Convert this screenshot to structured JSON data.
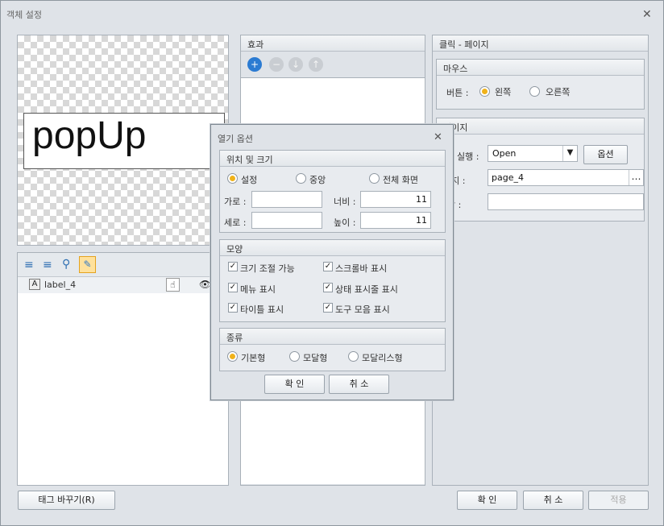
{
  "window": {
    "title": "객체 설정"
  },
  "preview": {
    "text": "popUp"
  },
  "layer": {
    "item_label": "label_4"
  },
  "buttons": {
    "tag_change": "태그 바꾸기(R)",
    "ok": "확 인",
    "cancel": "취 소",
    "apply": "적용"
  },
  "effects": {
    "header": "효과"
  },
  "right_panel": {
    "header": "클릭 - 페이지",
    "mouse": {
      "header": "마우스",
      "button_label": "버튼 :",
      "left": "왼쪽",
      "right": "오른쪽",
      "selected": "왼쪽"
    },
    "page": {
      "header": "페이지",
      "execute_label": "실행 :",
      "execute_value": "Open",
      "option_button": "옵션",
      "page_label": "이지 :",
      "page_value": "page_4",
      "window_label": "창 :"
    }
  },
  "dialog": {
    "title": "열기 옵션",
    "position": {
      "header": "위치 및 크기",
      "radio": [
        "설정",
        "중앙",
        "전체 화면"
      ],
      "selected": "설정",
      "x_label": "가로 :",
      "y_label": "세로 :",
      "width_label": "너비 :",
      "height_label": "높이 :",
      "width": "11",
      "height": "11"
    },
    "shape": {
      "header": "모양",
      "options": [
        {
          "label": "크기 조절 가능",
          "checked": true
        },
        {
          "label": "스크롤바 표시",
          "checked": true
        },
        {
          "label": "메뉴 표시",
          "checked": true
        },
        {
          "label": "상태 표시줄 표시",
          "checked": true
        },
        {
          "label": "타이틀 표시",
          "checked": true
        },
        {
          "label": "도구 모음 표시",
          "checked": true
        }
      ]
    },
    "type": {
      "header": "종류",
      "options": [
        "기본형",
        "모달형",
        "모달리스형"
      ],
      "selected": "기본형"
    },
    "ok": "확 인",
    "cancel": "취 소"
  },
  "icons": {
    "close": "close-icon",
    "add": "plus-icon",
    "remove": "minus-icon",
    "down": "arrow-down-icon",
    "up": "arrow-up-icon",
    "check": "checkmark-icon"
  }
}
